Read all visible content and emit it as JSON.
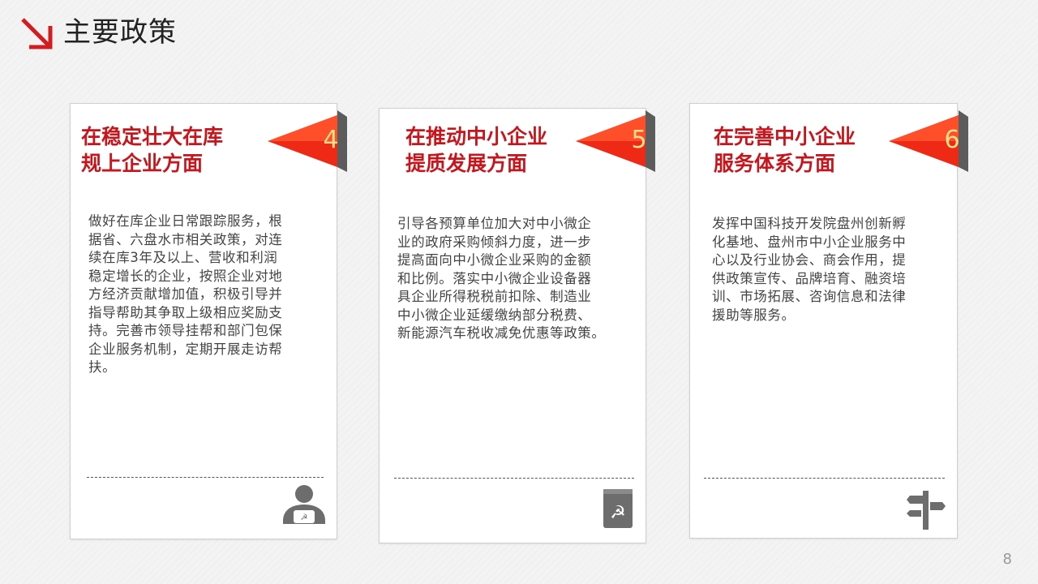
{
  "header": {
    "title": "主要政策"
  },
  "cards": [
    {
      "number": "4",
      "title_line1": "在稳定壮大在库",
      "title_line2": "规上企业方面",
      "body_lines": [
        "做好在库企业日常跟踪服务，根",
        "据省、六盘水市相关政策，对连",
        "续在库3年及以上、营收和利润",
        "稳定增长的企业，按照企业对地",
        "方经济贡献增加值，积极引导并",
        "指导帮助其争取上级相应奖励支",
        "持。完善市领导挂帮和部门包保",
        "企业服务机制，定期开展走访帮",
        "扶。"
      ],
      "icon": "party-member-person-icon"
    },
    {
      "number": "5",
      "title_line1": "在推动中小企业",
      "title_line2": "提质发展方面",
      "body_lines": [
        "引导各预算单位加大对中小微企",
        "业的政府采购倾斜力度，进一步",
        "提高面向中小微企业采购的金额",
        "和比例。落实中小微企业设备器",
        "具企业所得税税前扣除、制造业",
        "中小微企业延缓缴纳部分税费、",
        "新能源汽车税收减免优惠等政策。"
      ],
      "icon": "party-book-icon"
    },
    {
      "number": "6",
      "title_line1": "在完善中小企业",
      "title_line2": "服务体系方面",
      "body_lines": [
        "发挥中国科技开发院盘州创新孵",
        "化基地、盘州市中小企业服务中",
        "心以及行业协会、商会作用，提",
        "供政策宣传、品牌培育、融资培",
        "训、市场拓展、咨询信息和法律",
        "援助等服务。"
      ],
      "icon": "signpost-icon"
    }
  ],
  "footer": {
    "page_number": "8"
  },
  "colors": {
    "accent": "#c8151c",
    "flag_light": "#ff5a2a",
    "flag_dark": "#e01b12",
    "number": "#ffe08a"
  }
}
